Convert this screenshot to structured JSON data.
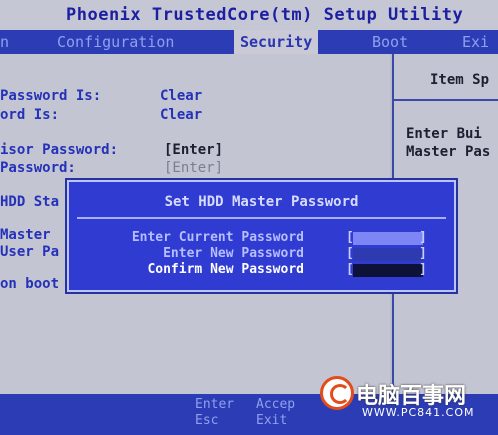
{
  "window": {
    "title": "Phoenix TrustedCore(tm) Setup Utility"
  },
  "menu": {
    "items": [
      {
        "label": "n"
      },
      {
        "label": "Configuration"
      },
      {
        "label": "Security"
      },
      {
        "label": "Boot"
      },
      {
        "label": "Exi"
      }
    ],
    "active": "Security"
  },
  "main": {
    "rows": [
      {
        "label": " Password Is:",
        "value": "Clear"
      },
      {
        "label": "ord Is:",
        "value": "Clear"
      },
      {
        "label": "isor Password:",
        "value": "[Enter]"
      },
      {
        "label": " Password:",
        "value": "[Enter]"
      },
      {
        "label": "HDD Sta"
      },
      {
        "label": "Master"
      },
      {
        "label": "User Pa"
      },
      {
        "label": "on boot"
      }
    ]
  },
  "side": {
    "heading": "Item Sp",
    "help_line1": "Enter Bui",
    "help_line2": "Master Pas"
  },
  "dialog": {
    "title": "Set HDD Master Password",
    "fields": [
      {
        "label": "Enter Current Password",
        "box_color": "#7e86f5"
      },
      {
        "label": "Enter New Password",
        "box_color": "#2d3ab0"
      },
      {
        "label": "Confirm New Password",
        "box_color": "#0e1238"
      }
    ],
    "bracket_open": "[",
    "bracket_close": "]"
  },
  "footer": {
    "key1": "Enter",
    "action1": "Accep",
    "key2": "Esc",
    "action2": "Exit"
  },
  "watermark": {
    "text": "电脑百事网",
    "url": "WWW.PC841.COM"
  }
}
